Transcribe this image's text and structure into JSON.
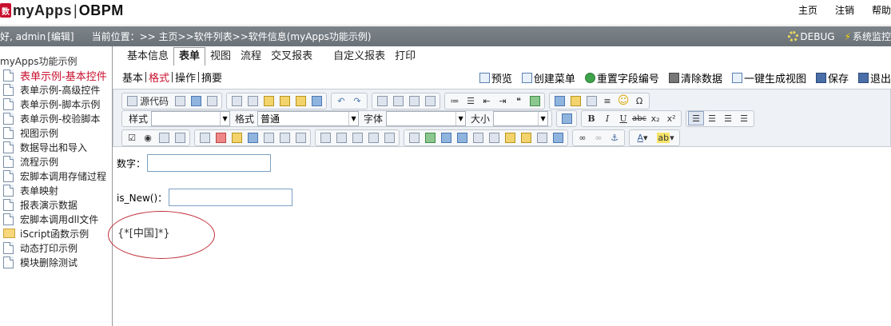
{
  "header": {
    "logo_mark": "数",
    "app_name": "myApps",
    "separator": "|",
    "product": "OBPM",
    "nav": [
      "主页",
      "注销",
      "帮助"
    ]
  },
  "statusbar": {
    "greeting": "好, admin",
    "edit_link": "[编辑]",
    "location": "当前位置：>> 主页>>软件列表>>软件信息(myApps功能示例)",
    "debug_label": "DEBUG",
    "monitor_label": "系统监控"
  },
  "sidebar": {
    "root": "myApps功能示例",
    "items": [
      {
        "label": "表单示例-基本控件",
        "active": true,
        "icon": "doc"
      },
      {
        "label": "表单示例-高级控件",
        "icon": "doc"
      },
      {
        "label": "表单示例-脚本示例",
        "icon": "doc"
      },
      {
        "label": "表单示例-校验脚本",
        "icon": "doc"
      },
      {
        "label": "视图示例",
        "icon": "doc"
      },
      {
        "label": "数据导出和导入",
        "icon": "doc"
      },
      {
        "label": "流程示例",
        "icon": "doc"
      },
      {
        "label": "宏脚本调用存储过程",
        "icon": "doc"
      },
      {
        "label": "表单映射",
        "icon": "doc"
      },
      {
        "label": "报表演示数据",
        "icon": "doc"
      },
      {
        "label": "宏脚本调用dll文件",
        "icon": "doc"
      },
      {
        "label": "iScript函数示例",
        "icon": "folder"
      },
      {
        "label": "动态打印示例",
        "icon": "doc"
      },
      {
        "label": "模块删除测试",
        "icon": "doc"
      }
    ]
  },
  "tabs": [
    "基本信息",
    "表单",
    "视图",
    "流程",
    "交叉报表",
    "自定义报表",
    "打印"
  ],
  "active_tab": "表单",
  "subtabs": [
    "基本",
    "格式",
    "操作",
    "摘要"
  ],
  "active_subtab": "格式",
  "actions": [
    "预览",
    "创建菜单",
    "重置字段编号",
    "清除数据",
    "一键生成视图",
    "保存",
    "退出"
  ],
  "toolbar": {
    "source_label": "源代码",
    "style_label": "样式",
    "format_label": "格式",
    "format_value": "普通",
    "font_label": "字体",
    "size_label": "大小",
    "bold": "B",
    "italic": "I",
    "underline": "U",
    "strike": "abc",
    "subscript": "x₂",
    "superscript": "x²",
    "omega": "Ω",
    "smile": "☺"
  },
  "content": {
    "number_label": "数字：",
    "isnew_label": "is_New()：",
    "script_text": "{*[中国]*}"
  },
  "colors": {
    "accent_red": "#c8102e",
    "statusbar_gray": "#6f777d",
    "annotation": "#c0303a"
  }
}
